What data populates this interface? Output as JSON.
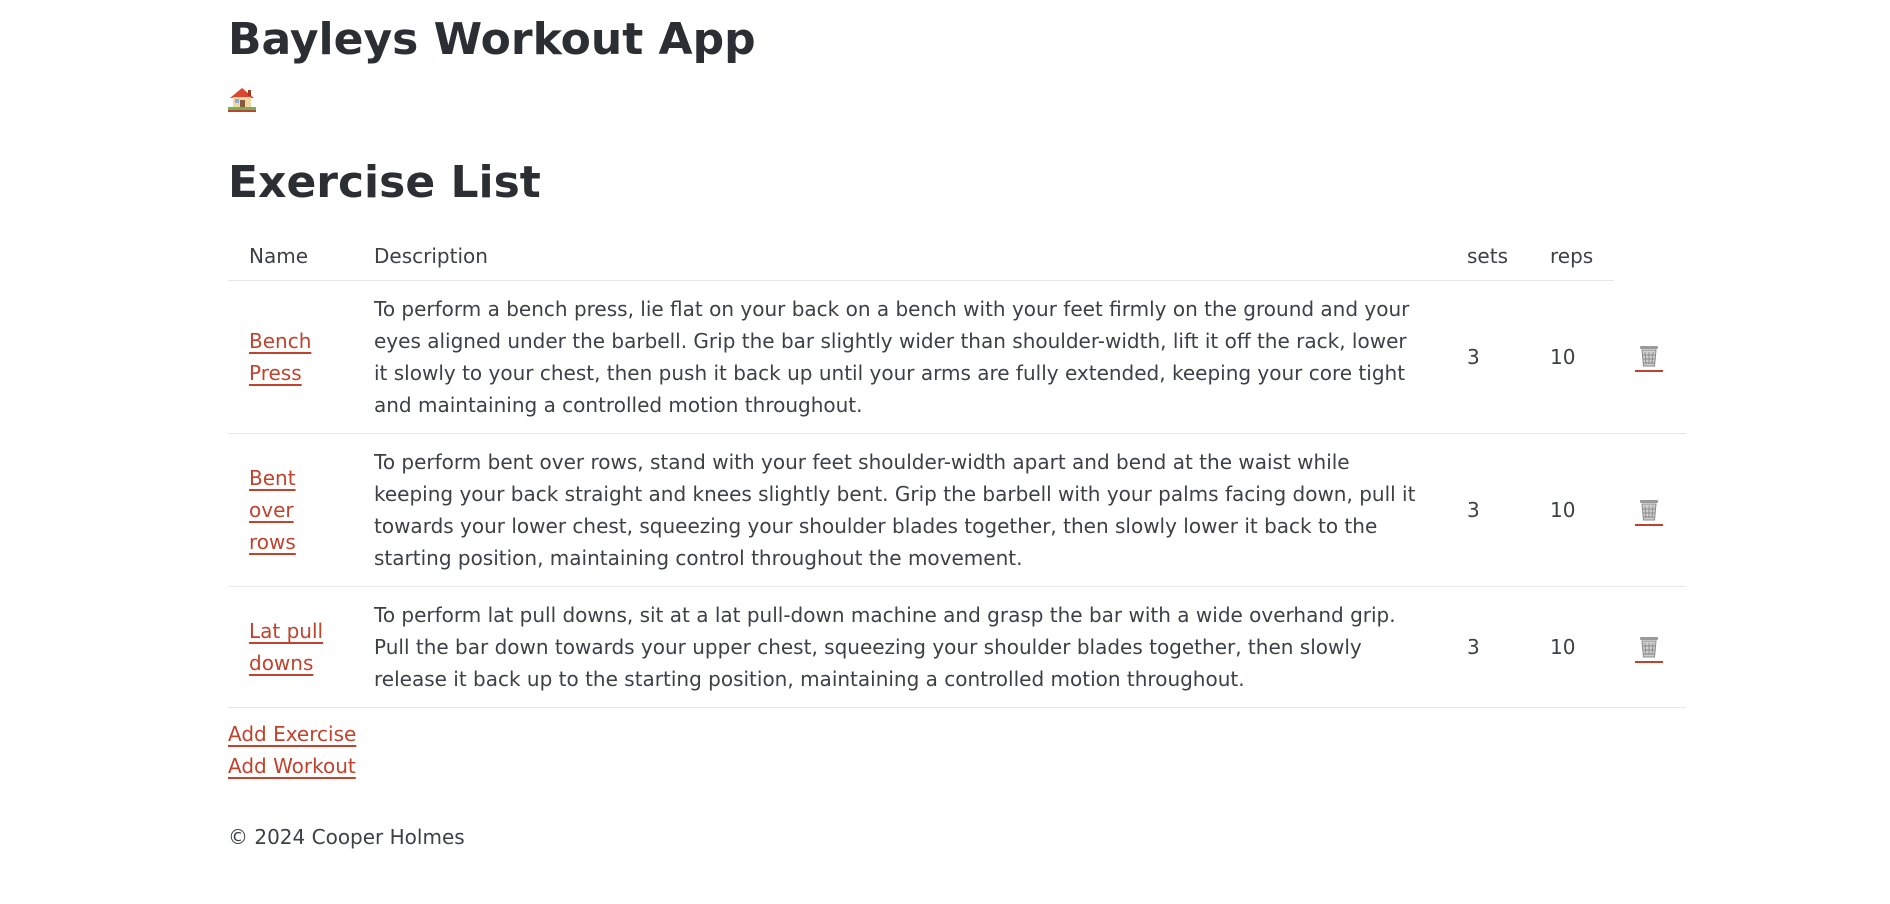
{
  "app": {
    "title": "Bayleys Workout App"
  },
  "nav": {
    "home_icon": "house-icon"
  },
  "page": {
    "title": "Exercise List"
  },
  "table": {
    "headers": {
      "name": "Name",
      "description": "Description",
      "sets": "sets",
      "reps": "reps"
    },
    "rows": [
      {
        "name": "Bench Press",
        "description": "To perform a bench press, lie flat on your back on a bench with your feet firmly on the ground and your eyes aligned under the barbell. Grip the bar slightly wider than shoulder-width, lift it off the rack, lower it slowly to your chest, then push it back up until your arms are fully extended, keeping your core tight and maintaining a controlled motion throughout.",
        "sets": "3",
        "reps": "10",
        "delete_icon": "trash-icon"
      },
      {
        "name": "Bent over rows",
        "description": "To perform bent over rows, stand with your feet shoulder-width apart and bend at the waist while keeping your back straight and knees slightly bent. Grip the barbell with your palms facing down, pull it towards your lower chest, squeezing your shoulder blades together, then slowly lower it back to the starting position, maintaining control throughout the movement.",
        "sets": "3",
        "reps": "10",
        "delete_icon": "trash-icon"
      },
      {
        "name": "Lat pull downs",
        "description": "To perform lat pull downs, sit at a lat pull-down machine and grasp the bar with a wide overhand grip. Pull the bar down towards your upper chest, squeezing your shoulder blades together, then slowly release it back up to the starting position, maintaining a controlled motion throughout.",
        "sets": "3",
        "reps": "10",
        "delete_icon": "trash-icon"
      }
    ]
  },
  "actions": {
    "add_exercise": "Add Exercise",
    "add_workout": "Add Workout"
  },
  "footer": {
    "copyright": "© 2024 Cooper Holmes"
  },
  "colors": {
    "link": "#c0432e",
    "text": "#3d4045",
    "heading": "#2b2e33",
    "row_border": "#e7e7e7"
  }
}
